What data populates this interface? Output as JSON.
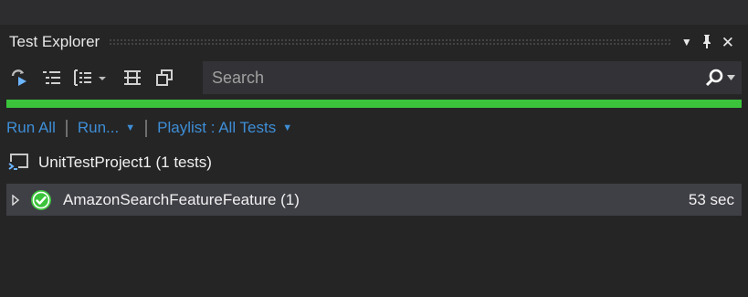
{
  "panel": {
    "title": "Test Explorer",
    "controls": {
      "dropdown_icon": "dropdown-arrow-icon",
      "pin_icon": "pin-icon",
      "close_icon": "close-icon"
    }
  },
  "toolbar": {
    "icons": [
      "run-tests-icon",
      "group-by-icon",
      "playlist-icon",
      "dropdown-arrow-icon",
      "expand-collapse-icon",
      "new-window-icon"
    ],
    "search": {
      "value": "",
      "placeholder": "Search",
      "icon": "search-icon"
    }
  },
  "progress": {
    "status": "passed",
    "fraction": 1.0,
    "color": "#3bc43b"
  },
  "commands": {
    "run_all": "Run All",
    "run": "Run...",
    "playlist": "Playlist : All Tests"
  },
  "tree": {
    "project": {
      "label": "UnitTestProject1 (1 tests)",
      "icon": "test-project-icon"
    },
    "tests": [
      {
        "name": "AmazonSearchFeatureFeature (1)",
        "duration": "53 sec",
        "status": "passed",
        "icon": "passed-check-icon"
      }
    ]
  },
  "colors": {
    "background": "#252526",
    "link": "#3e8ed6",
    "selected_row": "#3f3f46",
    "pass_green": "#3bc43b"
  }
}
